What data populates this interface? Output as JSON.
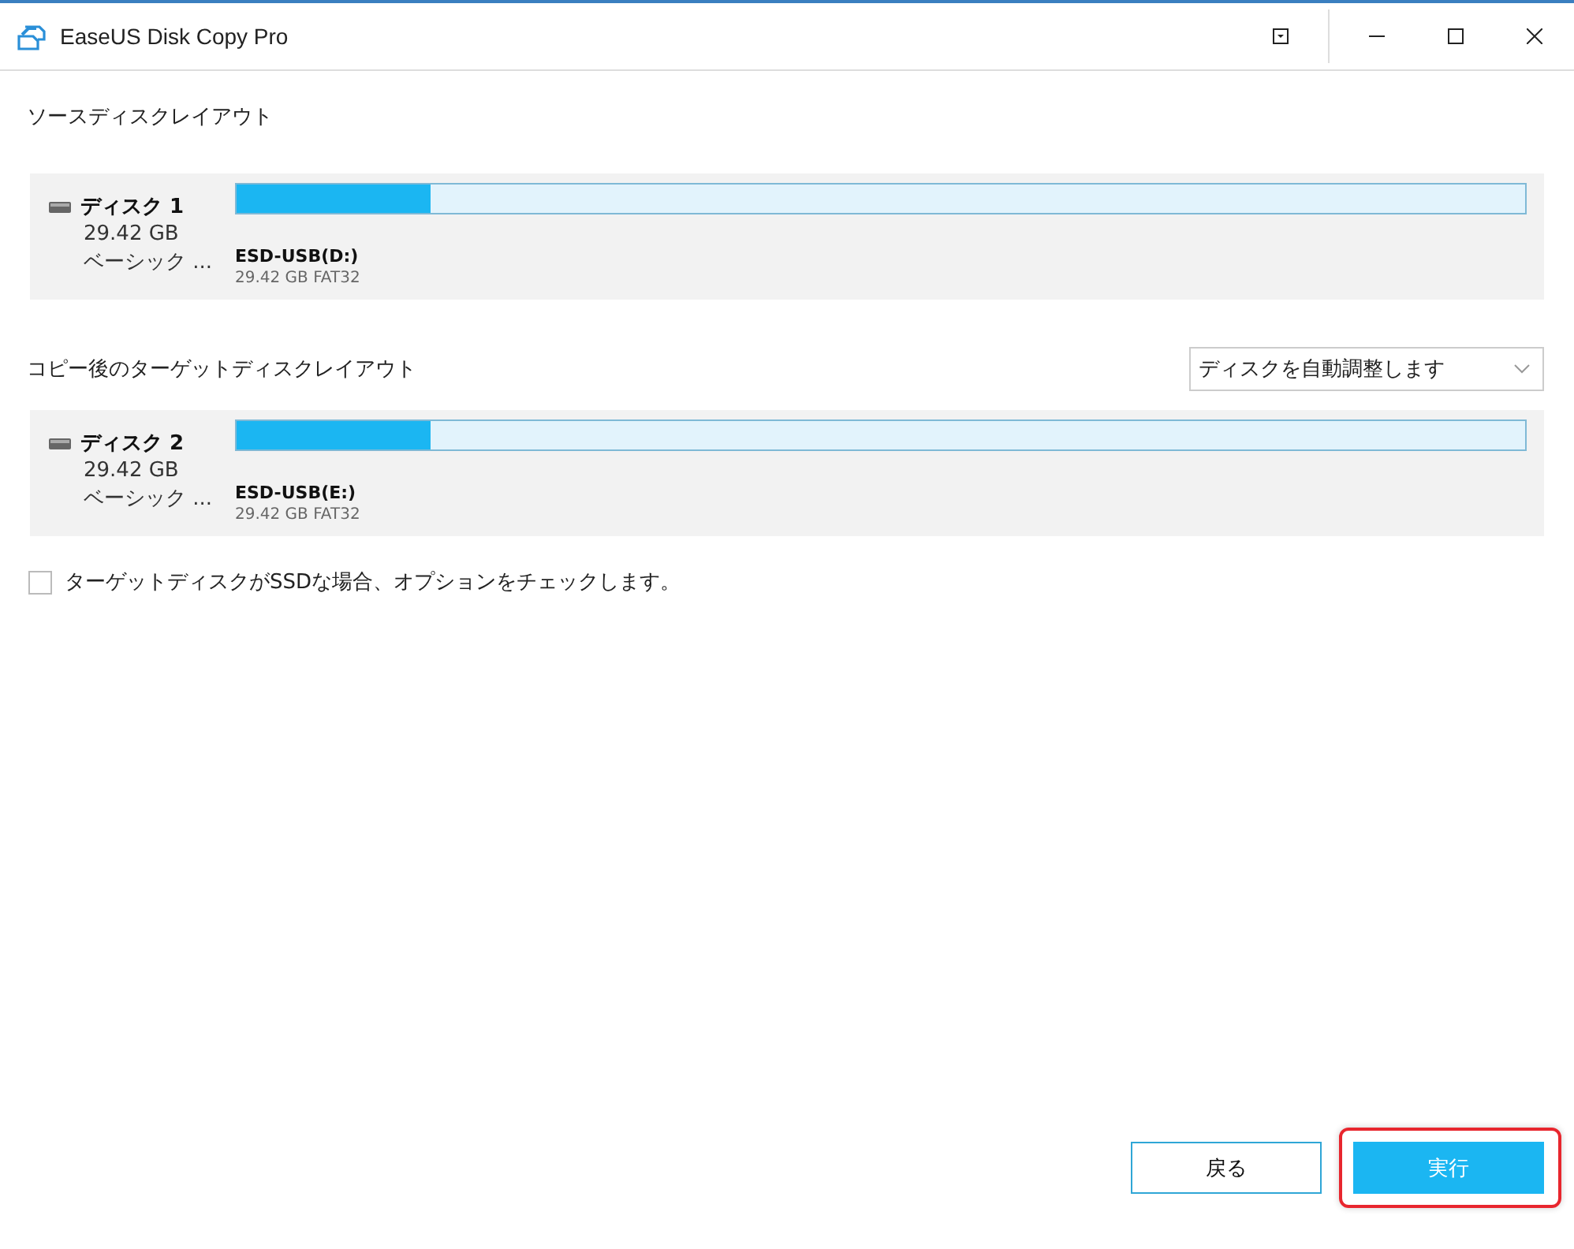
{
  "window": {
    "title": "EaseUS Disk Copy Pro"
  },
  "source": {
    "heading": "ソースディスクレイアウト",
    "disk": {
      "name": "ディスク 1",
      "size": "29.42 GB",
      "type": "ベーシック ...",
      "partition": {
        "label": "ESD-USB(D:)",
        "detail": "29.42 GB FAT32",
        "level": 0.15
      }
    }
  },
  "target": {
    "heading": "コピー後のターゲットディスクレイアウト",
    "dropdown": {
      "value": "ディスクを自動調整します"
    },
    "disk": {
      "name": "ディスク 2",
      "size": "29.42 GB",
      "type": "ベーシック ...",
      "partition": {
        "label": "ESD-USB(E:)",
        "detail": "29.42 GB FAT32",
        "level": 0.15
      }
    }
  },
  "ssd_option": {
    "label": "ターゲットディスクがSSDな場合、オプションをチェックします。",
    "checked": false
  },
  "buttons": [
    {
      "label": "戻る",
      "kind": "secondary",
      "highlighted": false
    },
    {
      "label": "実行",
      "kind": "primary",
      "highlighted": true
    }
  ]
}
